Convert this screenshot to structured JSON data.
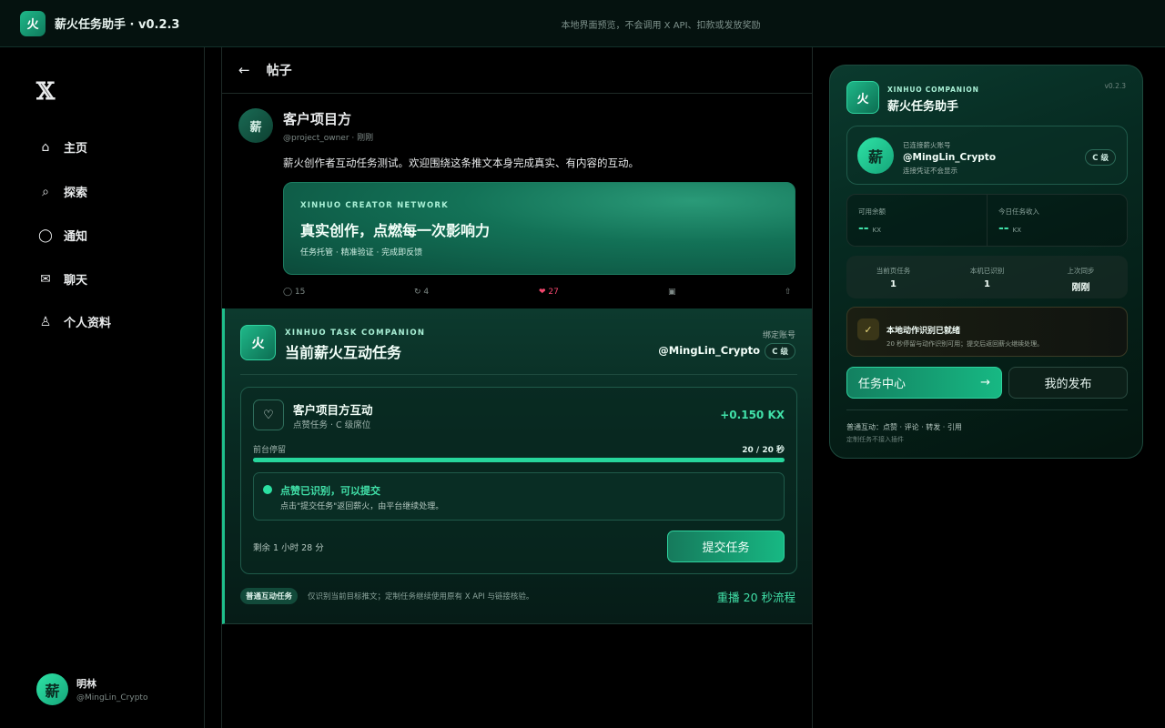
{
  "topbar": {
    "logo": "火",
    "title": "薪火任务助手 · v0.2.3",
    "note": "本地界面预览，不会调用 X API、扣款或发放奖励"
  },
  "nav": {
    "logo": "𝕏",
    "items": [
      {
        "label": "主页",
        "icon": "⌂"
      },
      {
        "label": "探索",
        "icon": "⌕"
      },
      {
        "label": "通知",
        "icon": "◯"
      },
      {
        "label": "聊天",
        "icon": "✉"
      },
      {
        "label": "个人资料",
        "icon": "♙"
      }
    ],
    "me": {
      "avatar": "薪",
      "name": "明林",
      "handle": "@MingLin_Crypto"
    }
  },
  "post": {
    "back": "←",
    "header": "帖子",
    "avatar": "薪",
    "author": "客户项目方",
    "handle": "@project_owner · 刚刚",
    "body": "薪火创作者互动任务测试。欢迎围绕这条推文本身完成真实、有内容的互动。",
    "banner": {
      "kicker": "XINHUO CREATOR NETWORK",
      "headline": "真实创作，点燃每一次影响力",
      "sub": "任务托管 · 精准验证 · 完成即反馈"
    },
    "actions": {
      "reply": "◯ 15",
      "retweet": "↻ 4",
      "like": "❤ 27",
      "views": "▣",
      "share": "⇧"
    }
  },
  "task": {
    "badge": "火",
    "kicker": "XINHUO TASK COMPANION",
    "title": "当前薪火互动任务",
    "bound_label": "绑定账号",
    "bound_account": "@MingLin_Crypto",
    "level": "C 级",
    "card": {
      "icon": "♡",
      "title": "客户项目方互动",
      "subtitle": "点赞任务 · C 级席位",
      "reward": "+0.150 KX",
      "progress_label": "前台停留",
      "progress_value": "20 / 20 秒",
      "progress_fraction": 1.0,
      "ok_title": "点赞已识别，可以提交",
      "ok_desc": "点击\"提交任务\"返回薪火，由平台继续处理。",
      "remaining": "剩余 1 小时 28 分",
      "submit": "提交任务"
    },
    "tag": "普通互动任务",
    "note": "仅识别当前目标推文；定制任务继续使用原有 X API 与链接核验。",
    "replay": "重播 20 秒流程"
  },
  "panel": {
    "badge": "火",
    "kicker": "XINHUO COMPANION",
    "title": "薪火任务助手",
    "version": "v0.2.3",
    "account": {
      "avatar": "薪",
      "label": "已连接薪火账号",
      "handle": "@MingLin_Crypto",
      "desc": "连接凭证不会显示",
      "level": "C 级"
    },
    "balance": [
      {
        "label": "可用余额",
        "value": "--",
        "unit": "KX"
      },
      {
        "label": "今日任务收入",
        "value": "--",
        "unit": "KX"
      }
    ],
    "stats": [
      {
        "label": "当前页任务",
        "value": "1"
      },
      {
        "label": "本机已识别",
        "value": "1"
      },
      {
        "label": "上次同步",
        "value": "刚刚"
      }
    ],
    "ready": {
      "icon": "✓",
      "title": "本地动作识别已就绪",
      "desc": "20 秒停留与动作识别可用；提交后返回薪火继续处理。"
    },
    "btn_task": "任务中心",
    "btn_task_arrow": "→",
    "btn_mine": "我的发布",
    "foot1": "普通互动：点赞 · 评论 · 转发 · 引用",
    "foot2": "定制任务不接入插件"
  },
  "colors": {
    "accent": "#41e0a8",
    "brand": "#17b883",
    "bg": "#000000"
  }
}
